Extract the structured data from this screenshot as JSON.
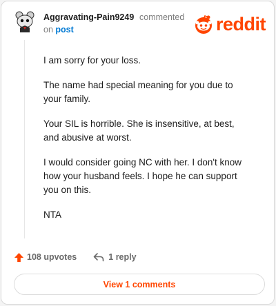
{
  "comment": {
    "author": "Aggravating-Pain9249",
    "action_text": "commented",
    "on_text": "on",
    "post_link": "post",
    "paragraphs": [
      "I am sorry for your loss.",
      "The name had special meaning for you due to your family.",
      "Your SIL is horrible. She is insensitive, at best, and abusive at worst.",
      "I would consider going NC with her. I don't know how your husband feels. I hope he can support you on this.",
      "NTA"
    ]
  },
  "brand": {
    "wordmark": "reddit",
    "color": "#ff4500"
  },
  "actions": {
    "upvotes_label": "108 upvotes",
    "reply_label": "1 reply",
    "upvote_icon": "upvote-arrow-icon",
    "reply_icon": "reply-arrow-icon"
  },
  "footer": {
    "view_comments_label": "View 1 comments"
  },
  "colors": {
    "accent": "#ff4500",
    "link": "#0079d3",
    "muted": "#7c7c7c"
  }
}
